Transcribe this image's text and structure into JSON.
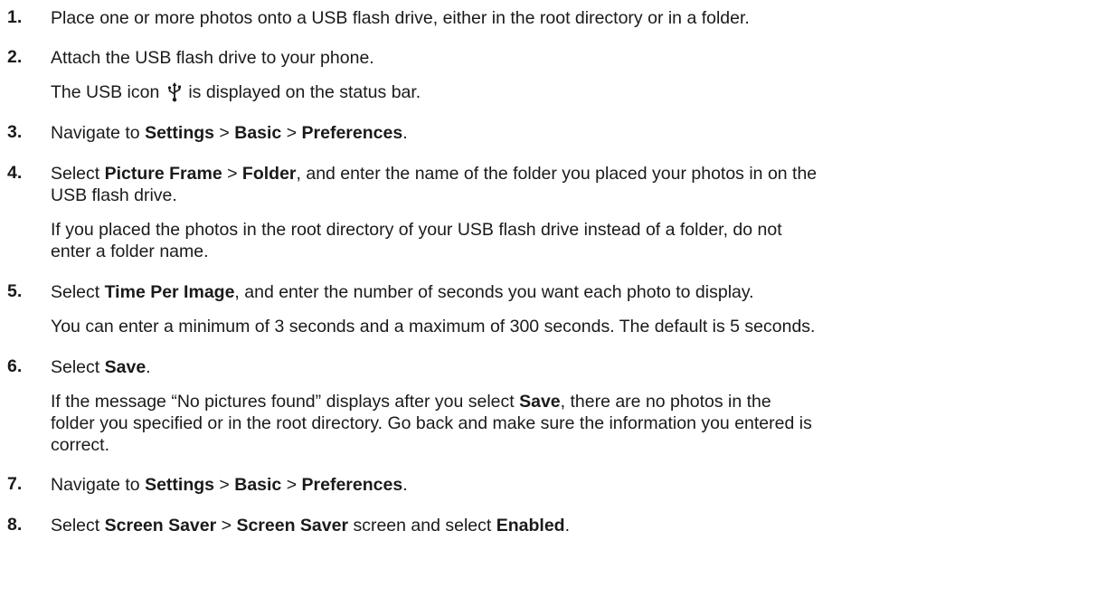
{
  "steps": [
    {
      "num": "1.",
      "text": "Place one or more photos onto a USB flash drive, either in the root directory or in a folder."
    },
    {
      "num": "2.",
      "text": "Attach the USB flash drive to your phone.",
      "note_before": "The USB icon",
      "note_icon": "usb-icon",
      "note_after": "is displayed on the status bar."
    },
    {
      "num": "3.",
      "t1": "Navigate to ",
      "b1": "Settings",
      "t2": " > ",
      "b2": "Basic",
      "t3": " > ",
      "b3": "Preferences",
      "t4": "."
    },
    {
      "num": "4.",
      "t1": "Select ",
      "b1": "Picture Frame",
      "t2": " > ",
      "b2": "Folder",
      "t3_line1": ", and enter the name of the folder you placed your photos in on the",
      "t3_line2": "USB flash drive.",
      "note_line1": "If you placed the photos in the root directory of your USB flash drive instead of a folder, do not",
      "note_line2": "enter a folder name."
    },
    {
      "num": "5.",
      "t1": "Select ",
      "b1": "Time Per Image",
      "t2": ", and enter the number of seconds you want each photo to display.",
      "note": "You can enter a minimum of 3 seconds and a maximum of 300 seconds. The default is 5 seconds."
    },
    {
      "num": "6.",
      "t1": "Select ",
      "b1": "Save",
      "t2": ".",
      "note1": "If the message “No pictures found” displays after you select ",
      "note_b": "Save",
      "note2": ", there are no photos in the",
      "note_line2": "folder you specified or in the root directory. Go back and make sure the information you entered is",
      "note_line3": "correct."
    },
    {
      "num": "7.",
      "t1": "Navigate to ",
      "b1": "Settings",
      "t2": " > ",
      "b2": "Basic",
      "t3": " > ",
      "b3": "Preferences",
      "t4": "."
    },
    {
      "num": "8.",
      "t1": "Select ",
      "b1": "Screen Saver",
      "t2": " > ",
      "b2": "Screen Saver",
      "t3": " screen and select ",
      "b3": "Enabled",
      "t4": "."
    }
  ]
}
